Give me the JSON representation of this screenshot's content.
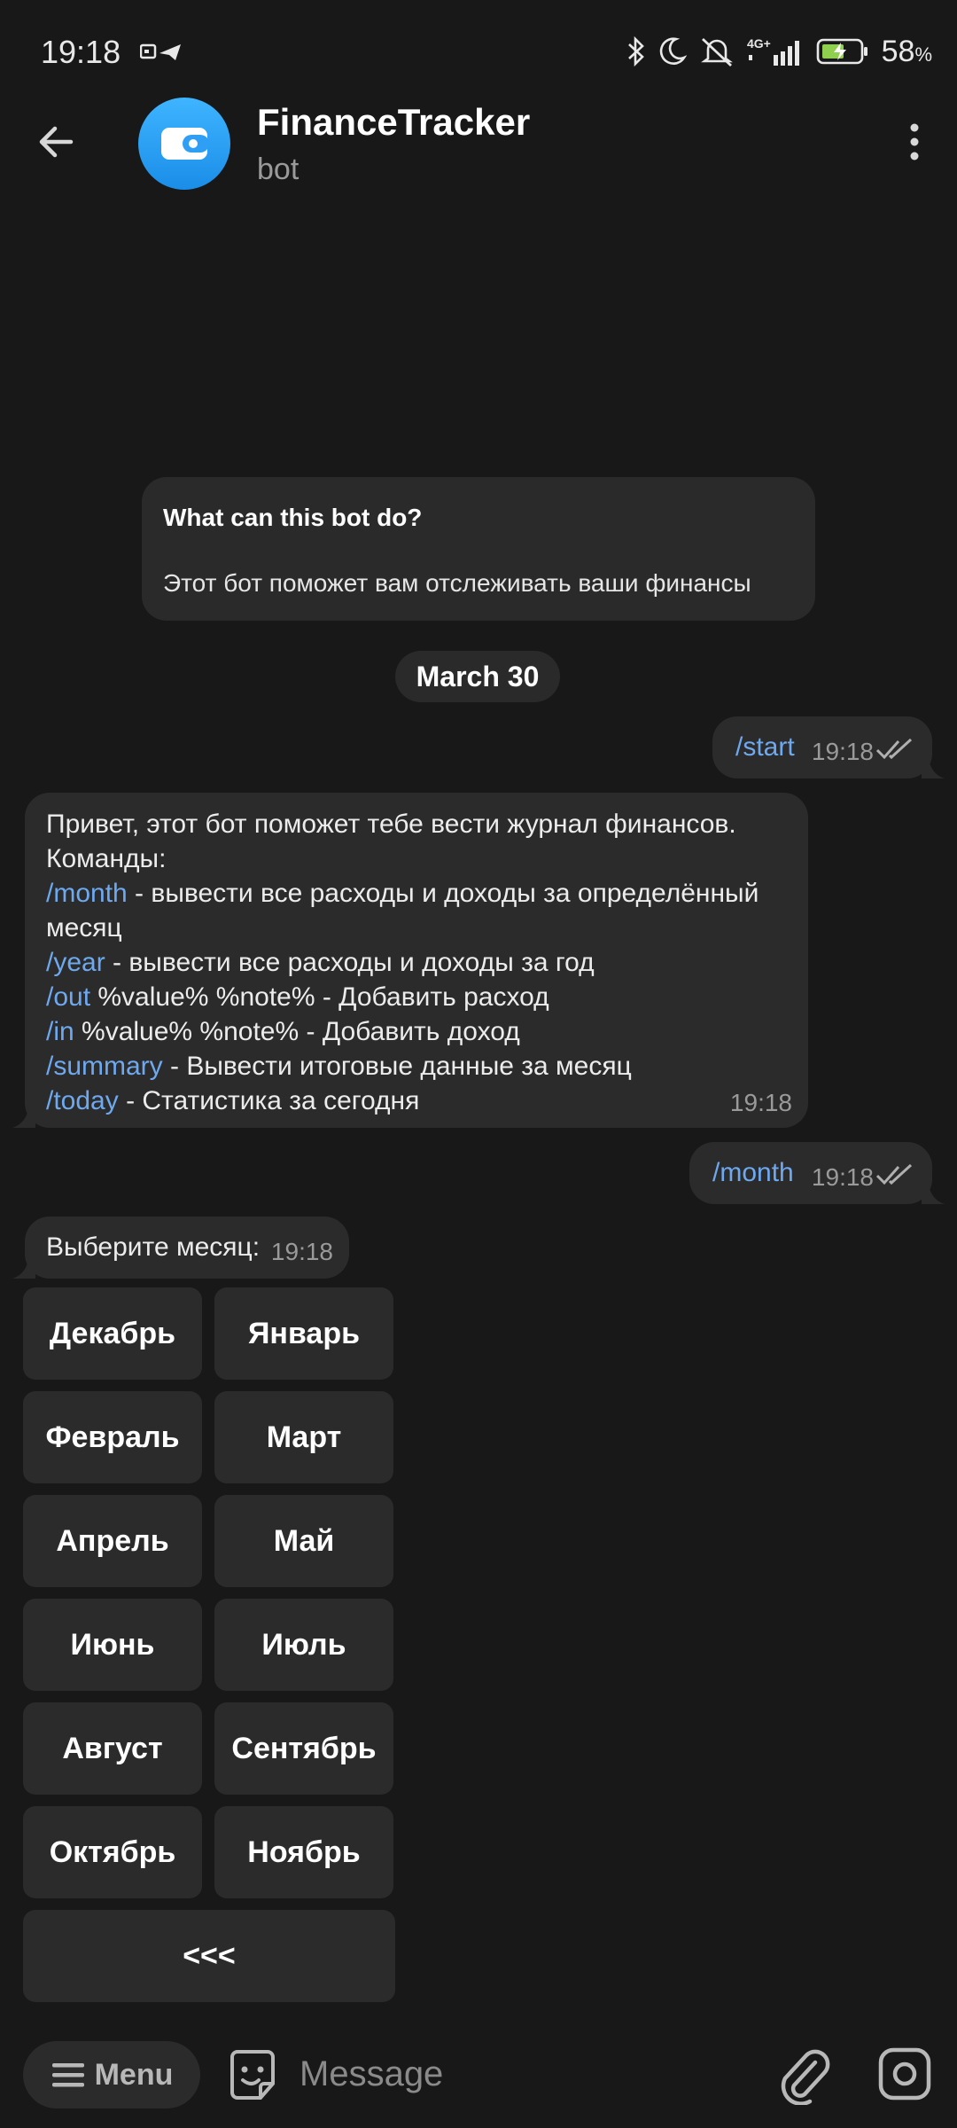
{
  "status_bar": {
    "time": "19:18",
    "battery_pct": "58",
    "battery_unit": "%",
    "network": "4G+"
  },
  "header": {
    "title": "FinanceTracker",
    "subtitle": "bot"
  },
  "bot_info": {
    "title": "What can this bot do?",
    "text": "Этот бот поможет вам отслеживать ваши финансы"
  },
  "date_chip": "March 30",
  "messages": {
    "out1": {
      "text": "/start",
      "time": "19:18"
    },
    "in1": {
      "lines": [
        {
          "cmd": "",
          "text": "Привет, этот бот поможет тебе вести журнал финансов."
        },
        {
          "cmd": "",
          "text": "Команды:"
        },
        {
          "cmd": "/month",
          "text": " - вывести все расходы и доходы за определённый"
        },
        {
          "cmd": "",
          "text": "месяц"
        },
        {
          "cmd": "/year",
          "text": " - вывести все расходы и доходы за год"
        },
        {
          "cmd": "/out",
          "text": " %value% %note% - Добавить расход"
        },
        {
          "cmd": "/in",
          "text": " %value% %note% - Добавить доход"
        },
        {
          "cmd": "/summary",
          "text": " - Вывести итоговые данные за месяц"
        },
        {
          "cmd": "/today",
          "text": " - Статистика за сегодня"
        }
      ],
      "time": "19:18"
    },
    "out2": {
      "text": "/month",
      "time": "19:18"
    },
    "in2": {
      "text": "Выберите месяц:",
      "time": "19:18"
    }
  },
  "keyboard": {
    "buttons": [
      "Декабрь",
      "Январь",
      "Февраль",
      "Март",
      "Апрель",
      "Май",
      "Июнь",
      "Июль",
      "Август",
      "Сентябрь",
      "Октябрь",
      "Ноябрь"
    ],
    "back": "<<<"
  },
  "input_bar": {
    "menu_label": "Menu",
    "placeholder": "Message"
  },
  "colors": {
    "background": "#181818",
    "bubble": "#2b2b2b",
    "link": "#6ea9f0",
    "avatar": "#2f9ff5"
  }
}
